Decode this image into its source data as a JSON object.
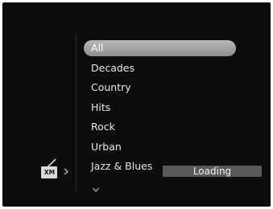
{
  "menu": {
    "items": [
      {
        "label": "All",
        "selected": true
      },
      {
        "label": "Decades",
        "selected": false
      },
      {
        "label": "Country",
        "selected": false
      },
      {
        "label": "Hits",
        "selected": false
      },
      {
        "label": "Rock",
        "selected": false
      },
      {
        "label": "Urban",
        "selected": false
      },
      {
        "label": "Jazz & Blues",
        "selected": false
      }
    ],
    "more_icon": "chevron-down-icon"
  },
  "source": {
    "logo_text": "XM",
    "icon": "xm-radio-icon",
    "arrow_icon": "chevron-right-icon"
  },
  "status": {
    "text": "Loading"
  },
  "colors": {
    "background": "#0d0d0d",
    "text": "#e6e6e6",
    "highlight": "#a3a3a3",
    "status_bar": "#5a5a5a"
  }
}
